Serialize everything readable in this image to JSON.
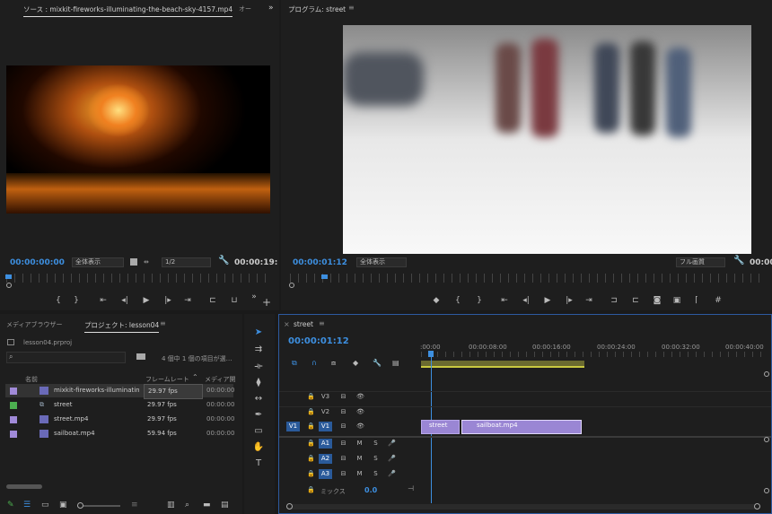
{
  "source": {
    "tab_title": "ソース : mixkit-fireworks-illuminating-the-beach-sky-4157.mp4",
    "tab_other": "オー",
    "timecode": "00:00:00:00",
    "zoom": "全体表示",
    "resolution": "1/2",
    "duration": "00:00:19:"
  },
  "program": {
    "tab_title": "プログラム: street",
    "timecode": "00:00:01:12",
    "zoom": "全体表示",
    "resolution": "フル画質",
    "duration": "00:00:"
  },
  "project": {
    "tab_media": "メディアブラウザー",
    "tab_project": "プロジェクト: lesson04",
    "file": "lesson04.prproj",
    "count": "4 個中 1 個の項目が選…",
    "columns": [
      "名前",
      "フレームレート",
      "メディア開"
    ],
    "items": [
      {
        "name": "mixkit-fireworks-illuminatin",
        "fps": "29.97 fps",
        "media": "00:00:00",
        "color": "#a08ad8"
      },
      {
        "name": "street",
        "fps": "29.97 fps",
        "media": "00:00:00",
        "color": "#4caf50"
      },
      {
        "name": "street.mp4",
        "fps": "29.97 fps",
        "media": "00:00:00",
        "color": "#a08ad8"
      },
      {
        "name": "sailboat.mp4",
        "fps": "59.94 fps",
        "media": "00:00:00",
        "color": "#a08ad8"
      }
    ]
  },
  "timeline": {
    "tab": "street",
    "timecode": "00:00:01:12",
    "ruler": [
      ":00:00",
      "00:00:08:00",
      "00:00:16:00",
      "00:00:24:00",
      "00:00:32:00",
      "00:00:40:00"
    ],
    "tracks": {
      "v3": "V3",
      "v2": "V2",
      "v1": "V1",
      "v1src": "V1",
      "a1": "A1",
      "a2": "A2",
      "a3": "A3",
      "mix": "ミックス",
      "mixval": "0.0",
      "m": "M",
      "s": "S"
    },
    "clips": [
      "street",
      "sailboat.mp4"
    ]
  },
  "icons": {
    "wrench": "wrench-icon",
    "play": "play-icon"
  }
}
